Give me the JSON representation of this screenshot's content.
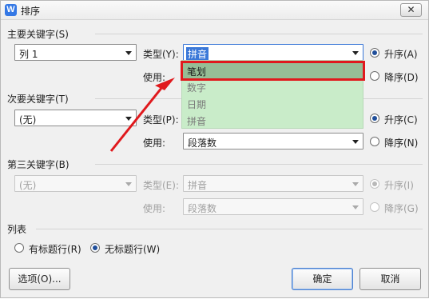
{
  "window": {
    "title": "排序",
    "app_icon_letter": "W",
    "close_label": "✕"
  },
  "primary": {
    "label": "主要关键字(S)",
    "key_value": "列 1",
    "type_label": "类型(Y):",
    "type_value": "拼音",
    "use_label": "使用:",
    "asc_label": "升序(A)",
    "desc_label": "降序(D)",
    "order": "asc",
    "dropdown_options": [
      "笔划",
      "数字",
      "日期",
      "拼音"
    ],
    "dropdown_highlighted": "笔划"
  },
  "secondary": {
    "label": "次要关键字(T)",
    "key_value": "(无)",
    "type_label": "类型(P):",
    "use_label": "使用:",
    "use_value": "段落数",
    "asc_label": "升序(C)",
    "desc_label": "降序(N)",
    "order": "asc"
  },
  "tertiary": {
    "label": "第三关键字(B)",
    "key_value": "(无)",
    "type_label": "类型(E):",
    "type_value": "拼音",
    "use_label": "使用:",
    "use_value": "段落数",
    "asc_label": "升序(I)",
    "desc_label": "降序(G)",
    "order": "asc",
    "disabled": true
  },
  "list": {
    "label": "列表",
    "has_header_label": "有标题行(R)",
    "no_header_label": "无标题行(W)",
    "selected": "no_header"
  },
  "buttons": {
    "options": "选项(O)...",
    "ok": "确定",
    "cancel": "取消"
  },
  "colors": {
    "highlight_border": "#e0191d",
    "dropdown_bg": "#c9ecc9",
    "arrow": "#e0191d"
  }
}
